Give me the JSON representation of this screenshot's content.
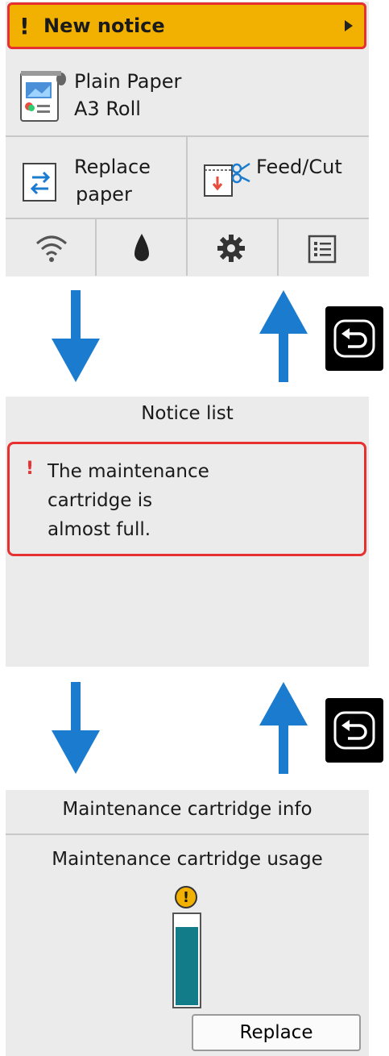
{
  "home": {
    "notice_label": "New notice",
    "notice_mark": "!",
    "paper_line1": "Plain Paper",
    "paper_line2": "A3 Roll",
    "replace_line1": "Replace",
    "replace_line2": "paper",
    "feed_cut": "Feed/Cut",
    "icons": [
      "wifi-icon",
      "ink-drop-icon",
      "gear-icon",
      "list-icon"
    ]
  },
  "notice_list": {
    "title": "Notice list",
    "item_mark": "!",
    "item_text": "The maintenance\ncartridge is\nalmost full."
  },
  "maintenance": {
    "title": "Maintenance cartridge info",
    "usage_label": "Maintenance cartridge usage",
    "warn_mark": "!",
    "usage_fraction": 0.88,
    "replace_label": "Replace"
  },
  "colors": {
    "notice_bar": "#f2b100",
    "alert_border": "#e73030",
    "arrow": "#1b7ccf",
    "gauge_fill": "#127d88"
  }
}
